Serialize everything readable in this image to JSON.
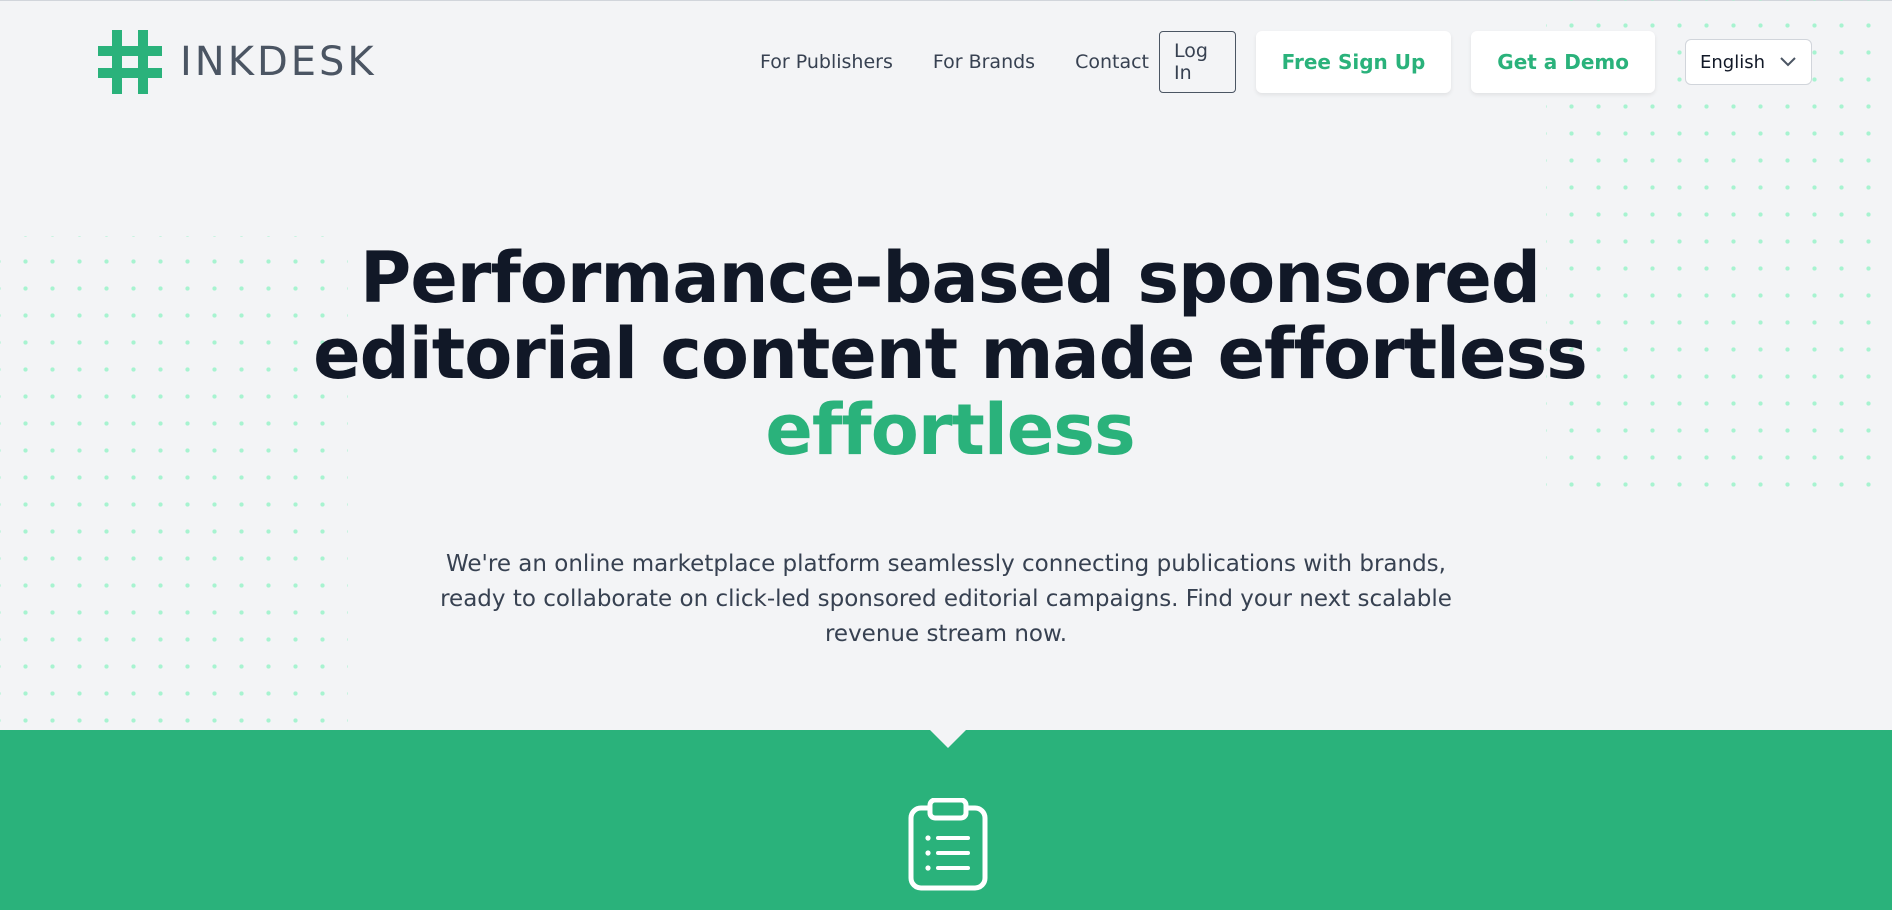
{
  "brand": {
    "name": "INKDESK",
    "accent_color": "#2ab27b",
    "logo_icon": "hash-icon"
  },
  "nav": {
    "publishers": "For Publishers",
    "brands": "For Brands",
    "contact": "Contact",
    "login": "Log In",
    "signup": "Free Sign Up",
    "demo": "Get a Demo",
    "language": "English",
    "language_icon": "chevron-down-icon"
  },
  "hero": {
    "line1": "Performance-based sponsored",
    "line2": "editorial content made effortless",
    "accent": "effortless",
    "subtitle": "We're an online marketplace platform seamlessly connecting publications with brands, ready to collaborate on click-led sponsored editorial campaigns. Find your next scalable revenue stream now."
  },
  "band": {
    "icon": "clipboard-icon",
    "color": "#2ab27b"
  }
}
